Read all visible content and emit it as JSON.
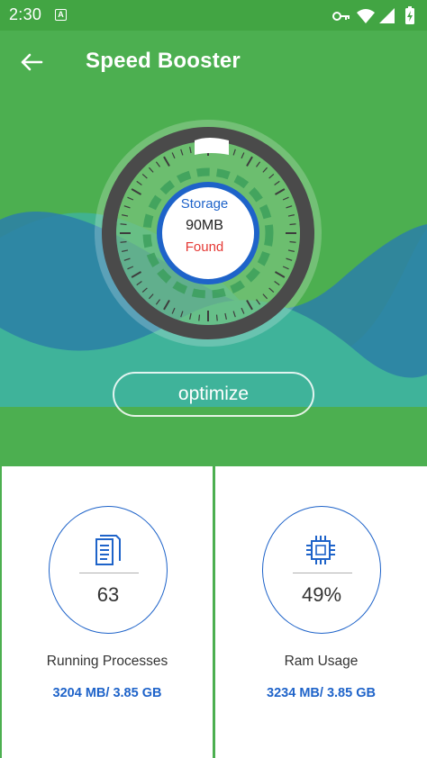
{
  "status_bar": {
    "time": "2:30",
    "notification_glyph": "A",
    "icons": [
      "key-icon",
      "wifi-icon",
      "signal-icon",
      "battery-charging-icon"
    ]
  },
  "app_bar": {
    "title": "Speed Booster",
    "back_icon": "arrow-back-icon"
  },
  "gauge": {
    "label": "Storage",
    "value": "90MB",
    "status": "Found"
  },
  "optimize_button": "optimize",
  "cards": [
    {
      "icon": "document-icon",
      "number": "63",
      "label": "Running Processes",
      "value": "3204 MB/ 3.85 GB"
    },
    {
      "icon": "cpu-chip-icon",
      "number": "49%",
      "label": "Ram Usage",
      "value": "3234 MB/ 3.85 GB"
    }
  ],
  "colors": {
    "primary_green": "#4caf50",
    "status_green": "#42a543",
    "wave_blue": "#2b7fa8",
    "wave_teal": "#3fb39a",
    "accent_blue": "#1e63c9",
    "found_red": "#e53935"
  }
}
